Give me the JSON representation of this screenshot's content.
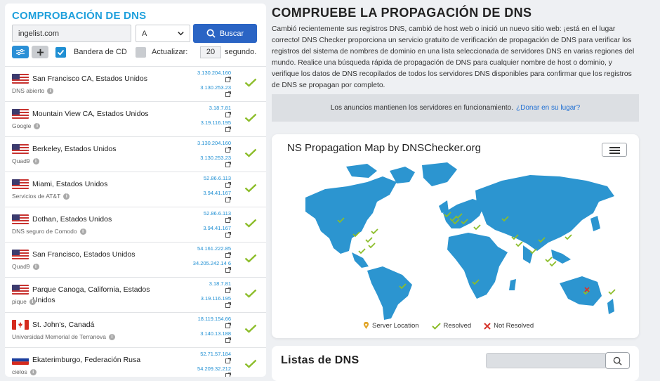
{
  "left": {
    "title": "COMPROBACIÓN DE DNS",
    "host_value": "ingelist.com",
    "record_type": "A",
    "search_label": "Buscar",
    "cd_flag_label": "Bandera de CD",
    "refresh_label": "Actualizar:",
    "refresh_value": "20",
    "refresh_unit": "segundo."
  },
  "servers": [
    {
      "location": "San Francisco CA, Estados Unidos",
      "provider": "DNS abierto",
      "flag": "us",
      "ips": [
        "3.130.204.160",
        "3.130.253.23"
      ],
      "status": "resolved"
    },
    {
      "location": "Mountain View CA, Estados Unidos",
      "provider": "Google",
      "flag": "us",
      "ips": [
        "3.18.7.81",
        "3.19.116.195"
      ],
      "status": "resolved"
    },
    {
      "location": "Berkeley, Estados Unidos",
      "provider": "Quad9",
      "flag": "us",
      "ips": [
        "3.130.204.160",
        "3.130.253.23"
      ],
      "status": "resolved"
    },
    {
      "location": "Miami, Estados Unidos",
      "provider": "Servicios de AT&T",
      "flag": "us",
      "ips": [
        "52.86.6.113",
        "3.94.41.167"
      ],
      "status": "resolved"
    },
    {
      "location": "Dothan, Estados Unidos",
      "provider": "DNS seguro de Comodo",
      "flag": "us",
      "ips": [
        "52.86.6.113",
        "3.94.41.167"
      ],
      "status": "resolved"
    },
    {
      "location": "San Francisco, Estados Unidos",
      "provider": "Quad9",
      "flag": "us",
      "ips": [
        "54.161.222.85",
        "34.205.242.14 6"
      ],
      "status": "resolved"
    },
    {
      "location": "Parque Canoga, California, Estados Unidos",
      "provider": "pique",
      "flag": "us",
      "ips": [
        "3.18.7.81",
        "3.19.116.195"
      ],
      "status": "resolved"
    },
    {
      "location": "St. John's, Canadá",
      "provider": "Universidad Memorial de Terranova",
      "flag": "ca",
      "ips": [
        "18.119.154.66",
        "3.140.13.188"
      ],
      "status": "resolved"
    },
    {
      "location": "Ekaterimburgo, Federación Rusa",
      "provider": "cielos",
      "flag": "ru",
      "ips": [
        "52.71.57.184",
        "54.209.32.212"
      ],
      "status": "resolved"
    }
  ],
  "main": {
    "title": "COMPRUEBE LA PROPAGACIÓN DE DNS",
    "description": "Cambió recientemente sus registros DNS, cambió de host web o inició un nuevo sitio web: ¡está en el lugar correcto! DNS Checker proporciona un servicio gratuito de verificación de propagación de DNS para verificar los registros del sistema de nombres de dominio en una lista seleccionada de servidores DNS en varias regiones del mundo. Realice una búsqueda rápida de propagación de DNS para cualquier nombre de host o dominio, y verifique los datos de DNS recopilados de todos los servidores DNS disponibles para confirmar que los registros de DNS se propagan por completo.",
    "ads_text": "Los anuncios mantienen los servidores en funcionamiento.",
    "ads_link": "¿Donar en su lugar?"
  },
  "map": {
    "title": "NS Propagation Map by DNSChecker.org",
    "legend_server": "Server Location",
    "legend_resolved": "Resolved",
    "legend_not_resolved": "Not Resolved"
  },
  "dns_list": {
    "title": "Listas de DNS"
  },
  "colors": {
    "accent": "#1fa0dc",
    "button": "#2a64c4",
    "ok": "#8cbd2a",
    "error": "#d6352b",
    "map_land": "#2c95d0"
  }
}
